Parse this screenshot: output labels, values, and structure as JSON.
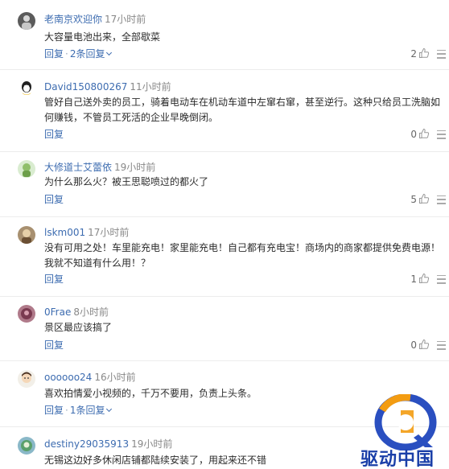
{
  "comments": [
    {
      "user": "老南京欢迎你",
      "time": "17小时前",
      "text": "大容量电池出来，全部歇菜",
      "reply_label": "回复",
      "more_replies": "2条回复",
      "likes": "2"
    },
    {
      "user": "David150800267",
      "time": "11小时前",
      "text": "管好自己送外卖的员工，骑着电动车在机动车道中左窜右窜，甚至逆行。这种只给员工洗脑如何赚钱，不管员工死活的企业早晚倒闭。",
      "reply_label": "回复",
      "likes": "0"
    },
    {
      "user": "大修道士艾蕾依",
      "time": "19小时前",
      "text": "为什么那么火？被王思聪喷过的都火了",
      "reply_label": "回复",
      "likes": "5"
    },
    {
      "user": "lskm001",
      "time": "17小时前",
      "text": "没有可用之处！车里能充电！家里能充电！自己都有充电宝！商场内的商家都提供免费电源！我就不知道有什么用！？",
      "reply_label": "回复",
      "likes": "1"
    },
    {
      "user": "0Frae",
      "time": "8小时前",
      "text": "景区最应该搞了",
      "reply_label": "回复",
      "likes": "0"
    },
    {
      "user": "oooooo24",
      "time": "16小时前",
      "text": "喜欢拍情爱小视频的，千万不要用，负责上头条。",
      "reply_label": "回复",
      "more_replies": "1条回复"
    },
    {
      "user": "destiny29035913",
      "time": "19小时前",
      "text": "无锡这边好多休闲店铺都陆续安装了，用起来还不错"
    }
  ],
  "watermark": {
    "text": "驱动中国"
  },
  "colors": {
    "link": "#3d6cb0",
    "logo_blue": "#1a3fa8",
    "logo_orange": "#f39c12"
  }
}
